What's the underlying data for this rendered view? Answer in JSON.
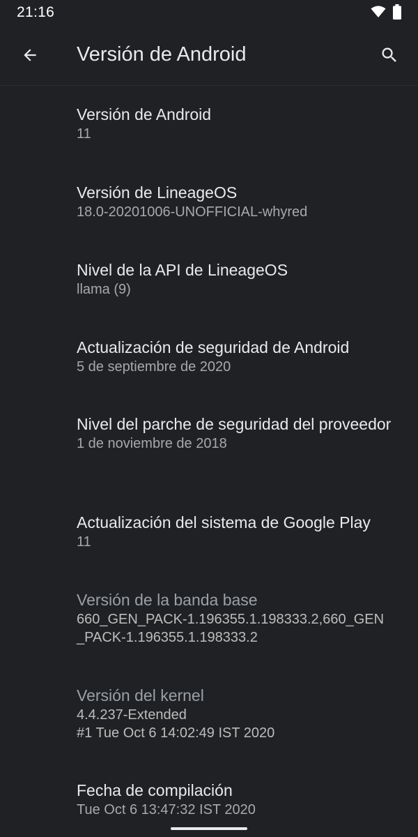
{
  "status_bar": {
    "time": "21:16",
    "icons": [
      "wifi-icon",
      "battery-icon"
    ]
  },
  "app_bar": {
    "title": "Versión de Android",
    "back_icon": "arrow-back-icon",
    "search_icon": "search-icon"
  },
  "items": [
    {
      "title": "Versión de Android",
      "summary": "11",
      "enabled": true
    },
    {
      "title": "Versión de LineageOS",
      "summary": "18.0-20201006-UNOFFICIAL-whyred",
      "enabled": true
    },
    {
      "title": "Nivel de la API de LineageOS",
      "summary": "llama (9)",
      "enabled": true
    },
    {
      "title": "Actualización de seguridad de Android",
      "summary": "5 de septiembre de 2020",
      "enabled": true
    },
    {
      "title": "Nivel del parche de seguridad del proveedor",
      "summary": "1 de noviembre de 2018",
      "enabled": true
    },
    {
      "title": "Actualización del sistema de Google Play",
      "summary": "11",
      "enabled": true
    },
    {
      "title": "Versión de la banda base",
      "summary": "660_GEN_PACK-1.196355.1.198333.2,660_GEN\n_PACK-1.196355.1.198333.2",
      "enabled": false
    },
    {
      "title": "Versión del kernel",
      "summary": "4.4.237-Extended\n#1 Tue Oct 6 14:02:49 IST 2020",
      "enabled": false
    },
    {
      "title": "Fecha de compilación",
      "summary": "Tue Oct  6 13:47:32 IST 2020",
      "enabled": true
    }
  ]
}
